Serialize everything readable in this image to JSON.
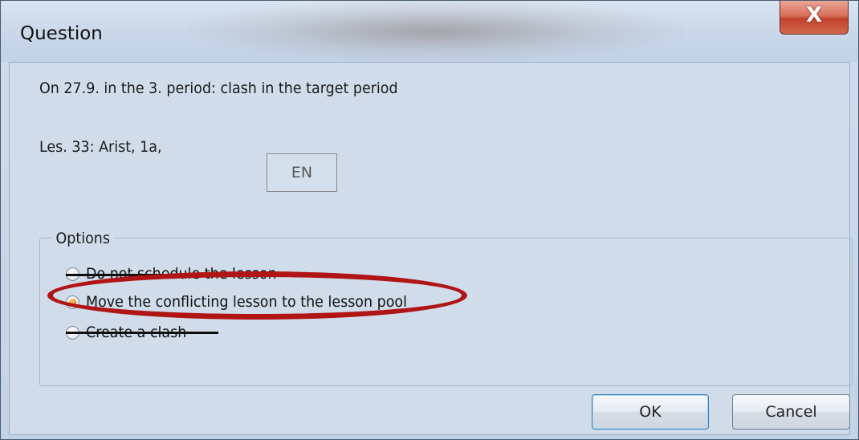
{
  "window": {
    "title": "Question",
    "close_glyph": "X"
  },
  "message": {
    "line1": "On  27.9. in the 3. period: clash in the target period",
    "lesson_info": "Les. 33: Arist, 1a,",
    "subject_code": "EN"
  },
  "options": {
    "legend": "Options",
    "items": [
      {
        "label": "Do not schedule the lesson",
        "checked": false
      },
      {
        "label": "Move the conflicting lesson to the lesson pool",
        "checked": true
      },
      {
        "label": "Create a clash",
        "checked": false
      }
    ]
  },
  "buttons": {
    "ok": "OK",
    "cancel": "Cancel"
  },
  "colors": {
    "highlight": "#b01414",
    "radio_selected": "#f08c1e"
  }
}
